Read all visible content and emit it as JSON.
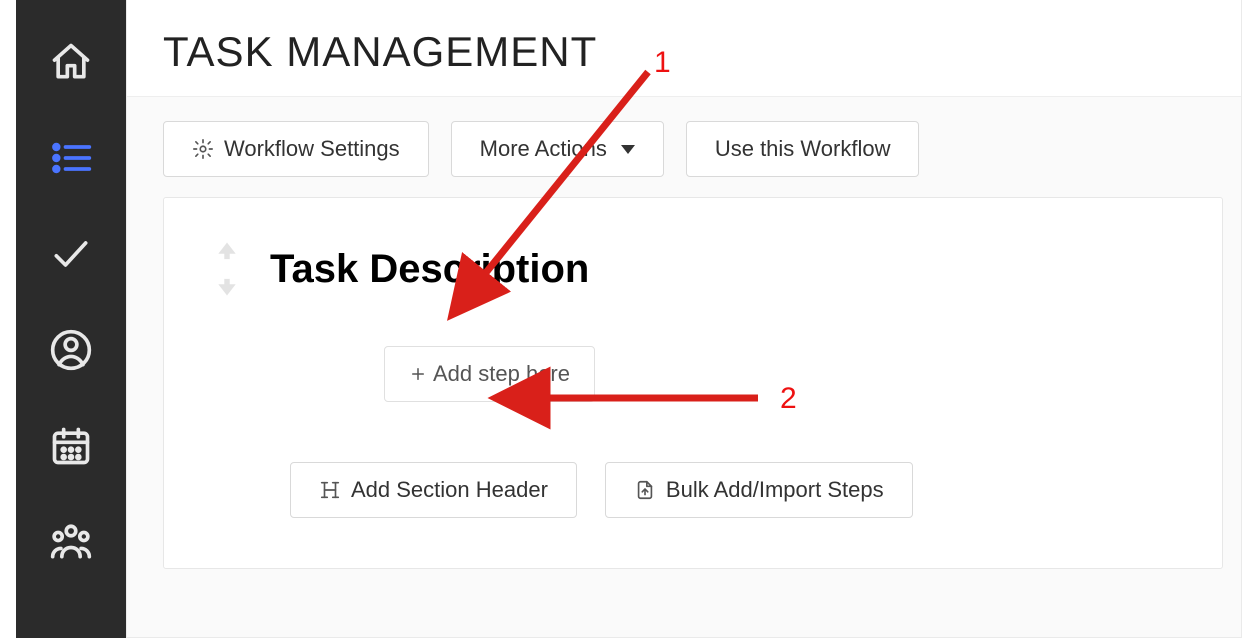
{
  "sidebar": {
    "items": [
      {
        "name": "home"
      },
      {
        "name": "list",
        "active": true
      },
      {
        "name": "check"
      },
      {
        "name": "user"
      },
      {
        "name": "calendar"
      },
      {
        "name": "people"
      }
    ]
  },
  "header": {
    "title": "TASK MANAGEMENT"
  },
  "toolbar": {
    "workflow_settings": "Workflow Settings",
    "more_actions": "More Actions",
    "use_workflow": "Use this Workflow"
  },
  "panel": {
    "task_title": "Task Description",
    "add_step": "Add step here",
    "add_section_header": "Add Section Header",
    "bulk_import": "Bulk Add/Import Steps"
  },
  "annotations": {
    "1": "1",
    "2": "2"
  }
}
